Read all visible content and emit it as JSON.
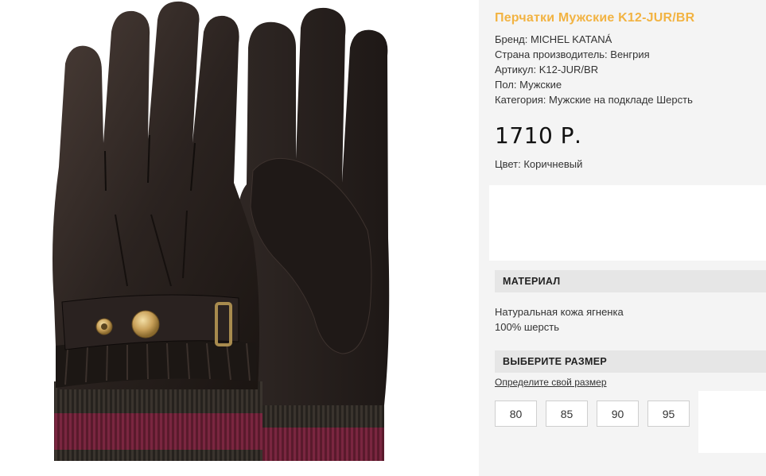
{
  "product": {
    "title": "Перчатки Мужские K12-JUR/BR",
    "specs": [
      "Бренд: MICHEL KATANÁ",
      "Страна производитель: Венгрия",
      "Артикул: K12-JUR/BR",
      "Пол: Мужские",
      "Категория: Мужские на подкладе Шерсть"
    ],
    "price": "1710 Р.",
    "color": "Цвет: Коричневый"
  },
  "material": {
    "header": "МАТЕРИАЛ",
    "lines": [
      "Натуральная кожа ягненка",
      "100% шерсть"
    ]
  },
  "size": {
    "header": "ВЫБЕРИТЕ РАЗМЕР",
    "link": "Определите свой размер",
    "options": [
      "80",
      "85",
      "90",
      "95"
    ]
  },
  "colors": {
    "title_accent": "#f2b342",
    "leather": "#2b2320",
    "cuff_burgundy": "#6e1d33",
    "cuff_dark": "#2e2a25",
    "buckle_gold": "#c9a15a"
  },
  "image": {
    "alt": "gloves-photo"
  }
}
